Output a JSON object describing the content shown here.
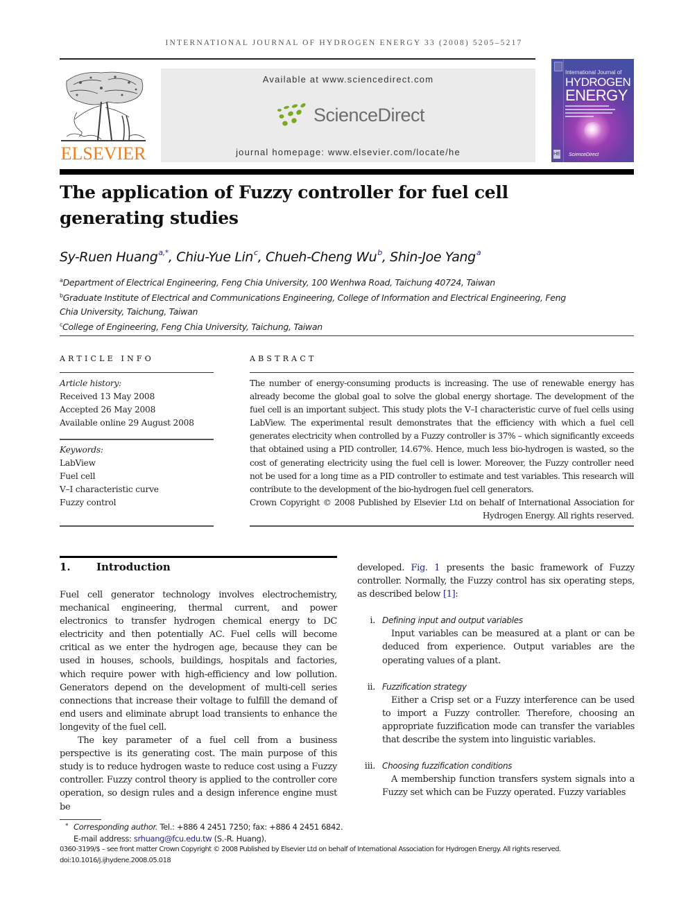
{
  "running_head": "INTERNATIONAL JOURNAL OF HYDROGEN ENERGY 33 (2008) 5205–5217",
  "publisher": {
    "logo_word": "ELSEVIER",
    "logo_color": "#f07d1a"
  },
  "sciencedirect": {
    "available_at": "Available at www.sciencedirect.com",
    "logo_text": "ScienceDirect",
    "logo_dot_color": "#7aaa22",
    "homepage": "journal homepage: www.elsevier.com/locate/he"
  },
  "cover": {
    "line1": "International Journal of",
    "line2": "HYDROGEN",
    "line3": "ENERGY",
    "badge": "HE",
    "footer": "ScienceDirect"
  },
  "article": {
    "title": "The application of Fuzzy controller for fuel cell generating studies",
    "authors": [
      {
        "name": "Sy-Ruen Huang",
        "sup": "a,*"
      },
      {
        "name": "Chiu-Yue Lin",
        "sup": "c"
      },
      {
        "name": "Chueh-Cheng Wu",
        "sup": "b"
      },
      {
        "name": "Shin-Joe Yang",
        "sup": "a"
      }
    ],
    "affiliations": [
      {
        "key": "a",
        "text": "Department of Electrical Engineering, Feng Chia University, 100 Wenhwa Road, Taichung 40724, Taiwan"
      },
      {
        "key": "b",
        "text": "Graduate Institute of Electrical and Communications Engineering, College of Information and Electrical Engineering, Feng Chia University, Taichung, Taiwan"
      },
      {
        "key": "c",
        "text": "College of Engineering, Feng Chia University, Taichung, Taiwan"
      }
    ]
  },
  "article_info": {
    "heading": "ARTICLE INFO",
    "history_label": "Article history:",
    "history": [
      "Received 13 May 2008",
      "Accepted 26 May 2008",
      "Available online 29 August 2008"
    ],
    "keywords_label": "Keywords:",
    "keywords": [
      "LabView",
      "Fuel cell",
      "V–I characteristic curve",
      "Fuzzy control"
    ]
  },
  "abstract": {
    "heading": "ABSTRACT",
    "body": "The number of energy-consuming products is increasing. The use of renewable energy has already become the global goal to solve the global energy shortage. The development of the fuel cell is an important subject. This study plots the V–I characteristic curve of fuel cells using LabView. The experimental result demonstrates that the efficiency with which a fuel cell generates electricity when controlled by a Fuzzy controller is 37% – which significantly exceeds that obtained using a PID controller, 14.67%. Hence, much less bio-hydrogen is wasted, so the cost of generating electricity using the fuel cell is lower. Moreover, the Fuzzy controller need not be used for a long time as a PID controller to estimate and test variables. This research will contribute to the development of the bio-hydrogen fuel cell generators.",
    "copyright": "Crown Copyright © 2008 Published by Elsevier Ltd on behalf of International Association for Hydrogen Energy. All rights reserved."
  },
  "introduction": {
    "number": "1.",
    "heading": "Introduction",
    "para1": "Fuel cell generator technology involves electrochemistry, mechanical engineering, thermal current, and power electronics to transfer hydrogen chemical energy to DC electricity and then potentially AC. Fuel cells will become critical as we enter the hydrogen age, because they can be used in houses, schools, buildings, hospitals and factories, which require power with high-efficiency and low pollution. Generators depend on the development of multi-cell series connections that increase their voltage to fulfill the demand of end users and eliminate abrupt load transients to enhance the longevity of the fuel cell.",
    "para2": "The key parameter of a fuel cell from a business perspective is its generating cost. The main purpose of this study is to reduce hydrogen waste to reduce cost using a Fuzzy controller. Fuzzy control theory is applied to the controller core operation, so design rules and a design inference engine must be",
    "right_lead_1": "developed. ",
    "right_fig_link": "Fig. 1",
    "right_lead_2": " presents the basic framework of Fuzzy controller. Normally, the Fuzzy control has six operating steps, as described below ",
    "right_ref_link": "[1]",
    "right_lead_3": ":",
    "steps": [
      {
        "numeral": "i.",
        "title": "Defining input and output variables",
        "body": "Input variables can be measured at a plant or can be deduced from experience. Output variables are the operating values of a plant."
      },
      {
        "numeral": "ii.",
        "title": "Fuzzification strategy",
        "body": "Either a Crisp set or a Fuzzy interference can be used to import a Fuzzy controller. Therefore, choosing an appropriate fuzzification mode can transfer the variables that describe the system into linguistic variables."
      },
      {
        "numeral": "iii.",
        "title": "Choosing fuzzification conditions",
        "body": "A membership function transfers system signals into a Fuzzy set which can be Fuzzy operated. Fuzzy variables"
      }
    ]
  },
  "footnote": {
    "star": "*",
    "corresponding_label": "Corresponding author.",
    "contact": " Tel.: +886 4 2451 7250; fax: +886 4 2451 6842.",
    "email_label": "E-mail address: ",
    "email": "srhuang@fcu.edu.tw",
    "email_suffix": " (S.-R. Huang).",
    "issn_line": "0360-3199/$ – see front matter Crown Copyright © 2008 Published by Elsevier Ltd on behalf of International Association for Hydrogen Energy. All rights reserved.",
    "doi": "doi:10.1016/j.ijhydene.2008.05.018"
  }
}
